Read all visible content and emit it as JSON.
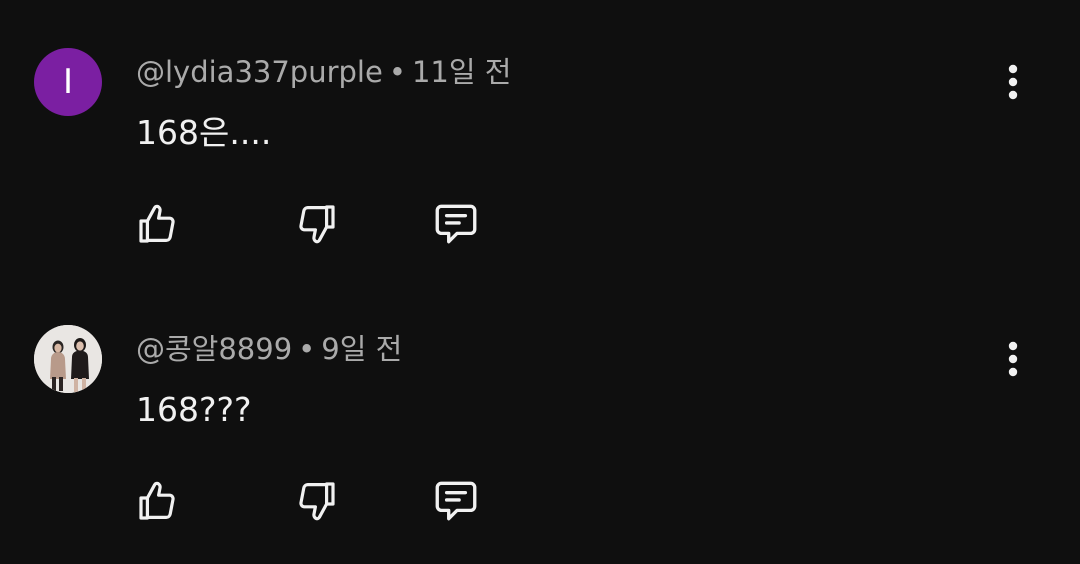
{
  "comments": [
    {
      "avatar_letter": "I",
      "avatar_color": "#7b1fa2",
      "handle": "@lydia337purple",
      "separator": "•",
      "time": "11일 전",
      "text": "168은....",
      "icons": [
        "thumb-up-icon",
        "thumb-down-icon",
        "reply-icon",
        "more-vert-icon"
      ]
    },
    {
      "avatar_letter": "",
      "handle": "@콩알8899",
      "separator": "•",
      "time": "9일 전",
      "text": "168???",
      "icons": [
        "thumb-up-icon",
        "thumb-down-icon",
        "reply-icon",
        "more-vert-icon"
      ]
    }
  ],
  "theme": {
    "background": "#0f0f0f",
    "text": "#f1f1f1",
    "secondary_text": "#aaaaaa"
  }
}
